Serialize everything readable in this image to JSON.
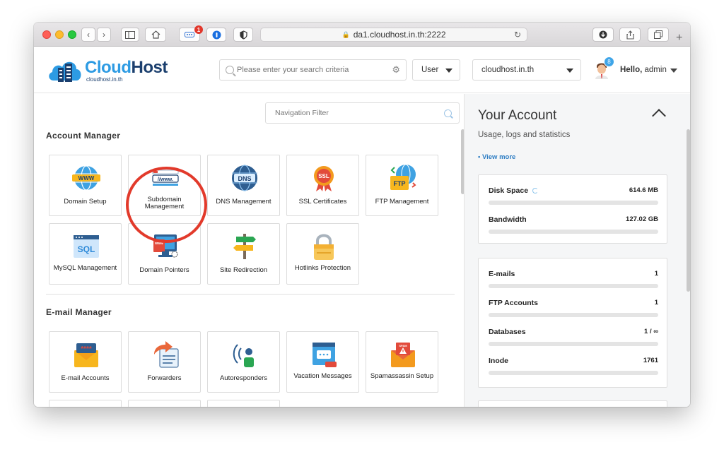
{
  "browser": {
    "url": "da1.cloudhost.in.th:2222",
    "extension_badge": "1",
    "lock_icon": "lock-icon",
    "reload_icon": "reload-icon"
  },
  "header": {
    "logo_text_a": "Cloud",
    "logo_text_b": "Host",
    "logo_sub": "cloudhost.in.th",
    "search_placeholder": "Please enter your search criteria",
    "role_select": "User",
    "domain_select": "cloudhost.in.th",
    "notifications": "8",
    "greeting": "Hello,",
    "username": "admin"
  },
  "nav": {
    "filter_placeholder": "Navigation Filter",
    "sections": [
      {
        "title": "Account Manager",
        "items": [
          {
            "label": "Domain Setup",
            "icon": "www-globe-icon"
          },
          {
            "label": "Subdomain Management",
            "icon": "subdomain-icon"
          },
          {
            "label": "DNS Management",
            "icon": "dns-globe-icon"
          },
          {
            "label": "SSL Certificates",
            "icon": "ssl-badge-icon"
          },
          {
            "label": "FTP Management",
            "icon": "ftp-folder-icon"
          },
          {
            "label": "MySQL Management",
            "icon": "sql-database-icon"
          },
          {
            "label": "Domain Pointers",
            "icon": "monitor-pointer-icon"
          },
          {
            "label": "Site Redirection",
            "icon": "signpost-icon"
          },
          {
            "label": "Hotlinks Protection",
            "icon": "padlock-icon"
          }
        ]
      },
      {
        "title": "E-mail Manager",
        "items": [
          {
            "label": "E-mail Accounts",
            "icon": "envelope-password-icon"
          },
          {
            "label": "Forwarders",
            "icon": "forward-arrow-icon"
          },
          {
            "label": "Autoresponders",
            "icon": "broadcast-person-icon"
          },
          {
            "label": "Vacation Messages",
            "icon": "calendar-chat-icon"
          },
          {
            "label": "Spamassassin Setup",
            "icon": "spam-envelope-icon"
          }
        ]
      }
    ]
  },
  "account": {
    "title": "Your Account",
    "subtitle": "Usage, logs and statistics",
    "view_more": "• View more",
    "usage": [
      {
        "name": "Disk Space",
        "value": "614.6 MB"
      },
      {
        "name": "Bandwidth",
        "value": "127.02 GB"
      }
    ],
    "counts": [
      {
        "name": "E-mails",
        "value": "1"
      },
      {
        "name": "FTP Accounts",
        "value": "1"
      },
      {
        "name": "Databases",
        "value": "1 / ∞"
      },
      {
        "name": "Inode",
        "value": "1761"
      }
    ]
  },
  "colors": {
    "accent": "#2d9be3",
    "highlight_circle": "#e23a2b",
    "brand_dark": "#1b3f6e"
  }
}
